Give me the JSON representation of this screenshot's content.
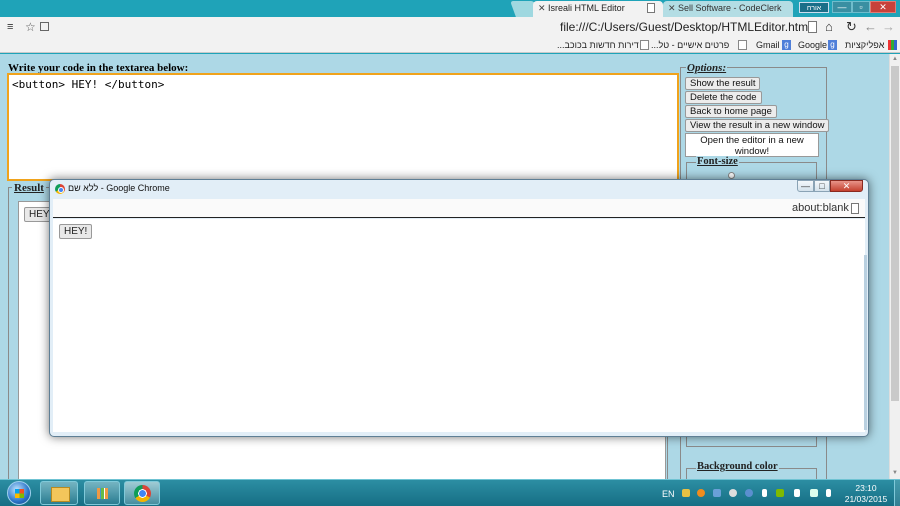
{
  "browser": {
    "tabs": [
      {
        "title": "Isreali HTML Editor",
        "active": true
      },
      {
        "title": "Sell Software - CodeClerk",
        "active": false
      }
    ],
    "user_badge": "אורח",
    "window_controls": {
      "minimize": "—",
      "maximize": "▫",
      "close": "✕"
    },
    "url": "file:///C:/Users/Guest/Desktop/HTMLEditor.html",
    "bookmarks": {
      "apps": "אפליקציות",
      "google": "Google",
      "gmail": "Gmail",
      "personal": "פרטים אישיים - טל...",
      "apartments": "דירות חדשות בכוכב..."
    },
    "icons": {
      "menu": "≡",
      "star": "☆",
      "home": "⌂",
      "reload": "↻",
      "back": "←",
      "forward": "→",
      "google_badge": "g",
      "scroll_up": "▲",
      "scroll_down": "▼"
    }
  },
  "editor": {
    "code_label": "Write your code in the textarea below:",
    "code": "<button> HEY! </button>",
    "result_legend": "Result",
    "result_button": "HEY!",
    "accent_color": "#f0a31c",
    "page_background": "#add8e6"
  },
  "options": {
    "legend": "Options:",
    "show_result": "Show the result",
    "delete_code": "Delete the code",
    "back_home": "Back to home page",
    "view_new_window": "View the result in a new window",
    "open_editor": "Open the editor in a new window!",
    "font_size_legend": "Font-size",
    "background_color_legend": "Background color"
  },
  "popup": {
    "title": "ללא שם - Google Chrome",
    "url": "about:blank",
    "button": "HEY!",
    "controls": {
      "minimize": "—",
      "maximize": "□",
      "close": "✕"
    }
  },
  "taskbar": {
    "language": "EN",
    "time": "23:10",
    "date": "21/03/2015"
  }
}
